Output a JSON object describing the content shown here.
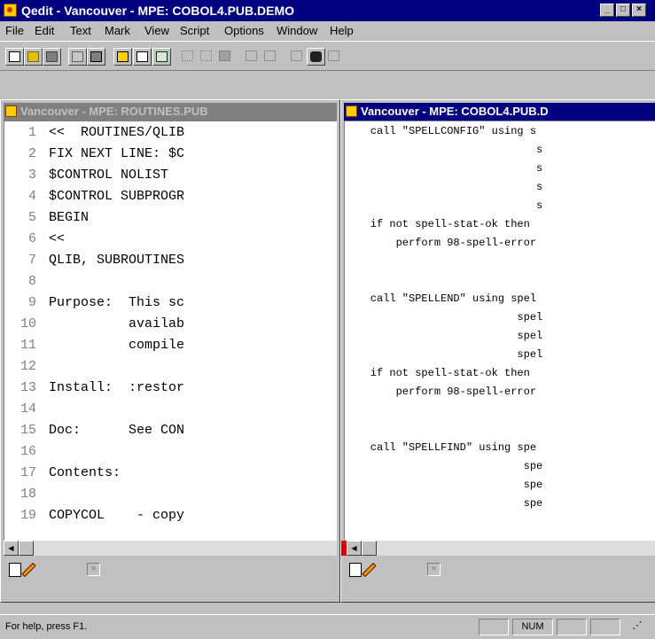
{
  "window": {
    "title": "Qedit - Vancouver - MPE: COBOL4.PUB.DEMO"
  },
  "menus": [
    "File",
    "Edit",
    "Text",
    "Mark",
    "View",
    "Script",
    "Options",
    "Window",
    "Help"
  ],
  "left_pane": {
    "title": "Vancouver - MPE: ROUTINES.PUB",
    "lines": [
      {
        "n": "1",
        "t": "<<  ROUTINES/QLIB"
      },
      {
        "n": "2",
        "t": "FIX NEXT LINE: $C"
      },
      {
        "n": "3",
        "t": "$CONTROL NOLIST"
      },
      {
        "n": "4",
        "t": "$CONTROL SUBPROGR"
      },
      {
        "n": "5",
        "t": "BEGIN"
      },
      {
        "n": "6",
        "t": "<<"
      },
      {
        "n": "7",
        "t": "QLIB, SUBROUTINES"
      },
      {
        "n": "8",
        "t": ""
      },
      {
        "n": "9",
        "t": "Purpose:  This sc"
      },
      {
        "n": "10",
        "t": "          availab"
      },
      {
        "n": "11",
        "t": "          compile"
      },
      {
        "n": "12",
        "t": ""
      },
      {
        "n": "13",
        "t": "Install:  :restor"
      },
      {
        "n": "14",
        "t": ""
      },
      {
        "n": "15",
        "t": "Doc:      See CON"
      },
      {
        "n": "16",
        "t": ""
      },
      {
        "n": "17",
        "t": "Contents:"
      },
      {
        "n": "18",
        "t": ""
      },
      {
        "n": "19",
        "t": "COPYCOL    - copy"
      }
    ]
  },
  "right_pane": {
    "title": "Vancouver - MPE: COBOL4.PUB.D",
    "lines": [
      "    call \"SPELLCONFIG\" using s",
      "                              s",
      "                              s",
      "                              s",
      "                              s",
      "    if not spell-stat-ok then",
      "        perform 98-spell-error",
      "",
      "",
      "    call \"SPELLEND\" using spel",
      "                           spel",
      "                           spel",
      "                           spel",
      "    if not spell-stat-ok then",
      "        perform 98-spell-error",
      "",
      "",
      "    call \"SPELLFIND\" using spe",
      "                            spe",
      "                            spe",
      "                            spe"
    ]
  },
  "statusbar": {
    "help": "For help, press F1.",
    "num": "NUM"
  }
}
